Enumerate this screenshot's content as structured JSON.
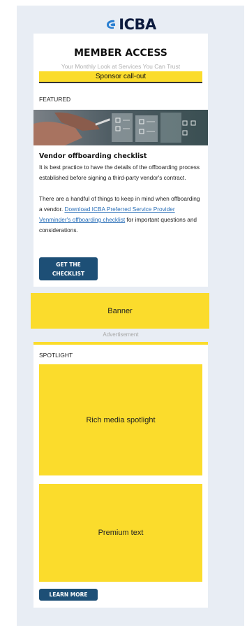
{
  "brand": {
    "logo_text": "ICBA",
    "logo_icon": "icba-swoosh-icon",
    "colors": {
      "navy": "#0d1b3e",
      "blue": "#1d4f76",
      "accent_blue": "#2a7fd1",
      "yellow": "#fbdc2c",
      "link": "#2a6fb8",
      "background": "#e8edf4"
    }
  },
  "header": {
    "title": "MEMBER ACCESS",
    "subtitle": "Your Monthly Look at Services You Can Trust",
    "sponsor_callout": "Sponsor call-out"
  },
  "featured": {
    "section_label": "FEATURED",
    "image_icon": "hands-with-tablet-checklist-image",
    "title": "Vendor offboarding checklist",
    "paragraph1": "It is best practice to have the details of the offboarding process established before signing a third-party vendor's contract.",
    "paragraph2_prefix": "There are a handful of things to keep in mind when offboarding a vendor. ",
    "paragraph2_link": "Download ICBA Preferred Service Provider Venminder's offboarding checklist",
    "paragraph2_suffix": " for important questions and considerations.",
    "cta_line1": "GET THE",
    "cta_line2": "CHECKLIST"
  },
  "banner": {
    "label": "Banner",
    "caption": "Advertisement"
  },
  "spotlight": {
    "section_label": "SPOTLIGHT",
    "rich_media_label": "Rich media spotlight",
    "premium_text_label": "Premium text",
    "cta": "LEARN MORE"
  }
}
